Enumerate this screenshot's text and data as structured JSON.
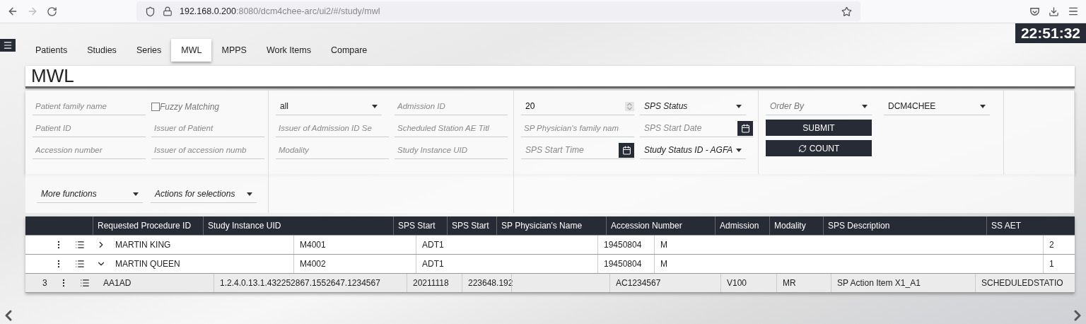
{
  "browser": {
    "url_host": "192.168.0.200",
    "url_path": ":8080/dcm4chee-arc/ui2/#/study/mwl"
  },
  "clock": "22:51:32",
  "tabs": [
    {
      "label": "Patients",
      "selected": false
    },
    {
      "label": "Studies",
      "selected": false
    },
    {
      "label": "Series",
      "selected": false
    },
    {
      "label": "MWL",
      "selected": true
    },
    {
      "label": "MPPS",
      "selected": false
    },
    {
      "label": "Work Items",
      "selected": false
    },
    {
      "label": "Compare",
      "selected": false
    }
  ],
  "page_title": "MWL",
  "filters": [
    {
      "columns": [
        [
          {
            "kind": "text",
            "placeholder": "Patient family name"
          },
          {
            "kind": "text",
            "placeholder": "Patient ID"
          },
          {
            "kind": "text",
            "placeholder": "Accession number"
          }
        ],
        [
          {
            "kind": "checkbox",
            "label": "Fuzzy Matching",
            "checked": false
          },
          {
            "kind": "text",
            "placeholder": "Issuer of Patient"
          },
          {
            "kind": "text",
            "placeholder": "Issuer of accession numb"
          }
        ]
      ]
    },
    {
      "columns": [
        [
          {
            "kind": "select",
            "value": "all"
          },
          {
            "kind": "text",
            "placeholder": "Issuer of Admission ID Se"
          },
          {
            "kind": "text",
            "placeholder": "Modality"
          }
        ],
        [
          {
            "kind": "text",
            "placeholder": "Admission ID"
          },
          {
            "kind": "text",
            "placeholder": "Scheduled Station AE Titl"
          },
          {
            "kind": "text",
            "placeholder": "Study Instance UID"
          }
        ]
      ]
    },
    {
      "columns": [
        [
          {
            "kind": "number",
            "value": "20"
          },
          {
            "kind": "text",
            "placeholder": "SP Physician's family nam"
          },
          {
            "kind": "date",
            "placeholder": "SPS Start Time"
          }
        ],
        [
          {
            "kind": "select",
            "label": "SPS Status"
          },
          {
            "kind": "date",
            "placeholder": "SPS Start Date"
          },
          {
            "kind": "select",
            "label": "Study Status ID - AGFA"
          }
        ]
      ]
    },
    {
      "columns": [
        [
          {
            "kind": "select",
            "placeholder": "Order By"
          },
          {
            "kind": "button",
            "label": "SUBMIT"
          },
          {
            "kind": "refresh_button",
            "label": "COUNT"
          }
        ],
        [
          {
            "kind": "select",
            "value": "DCM4CHEE"
          }
        ]
      ]
    }
  ],
  "actions": [
    {
      "kind": "select",
      "label": "More functions"
    },
    {
      "kind": "select",
      "label": "Actions for selections"
    }
  ],
  "table": {
    "columns": [
      "Requested Procedure ID",
      "Study Instance UID",
      "SPS Start",
      "SPS Start",
      "SP Physician's Name",
      "Accession Number",
      "Admission",
      "Modality",
      "SPS Description",
      "SS AET"
    ],
    "patients": [
      {
        "expanded": false,
        "cells": [
          "MARTIN KING",
          "M4001",
          "ADT1",
          "19450804",
          "M",
          "2"
        ]
      },
      {
        "expanded": true,
        "cells": [
          "MARTIN QUEEN",
          "M4002",
          "ADT1",
          "19450804",
          "M",
          "1"
        ]
      }
    ],
    "mwl_items": [
      {
        "index": "3",
        "requested_procedure_id": "AA1AD",
        "study_instance_uid": "1.2.4.0.13.1.432252867.1552647.1234567",
        "sps_start_date": "20211118",
        "sps_start_time": "223648.192",
        "accession_number": "AC1234567",
        "admission": "V100",
        "modality": "MR",
        "sps_description": "SP Action Item X1_A1",
        "ss_aet": "SCHEDULEDSTATIO"
      }
    ]
  }
}
